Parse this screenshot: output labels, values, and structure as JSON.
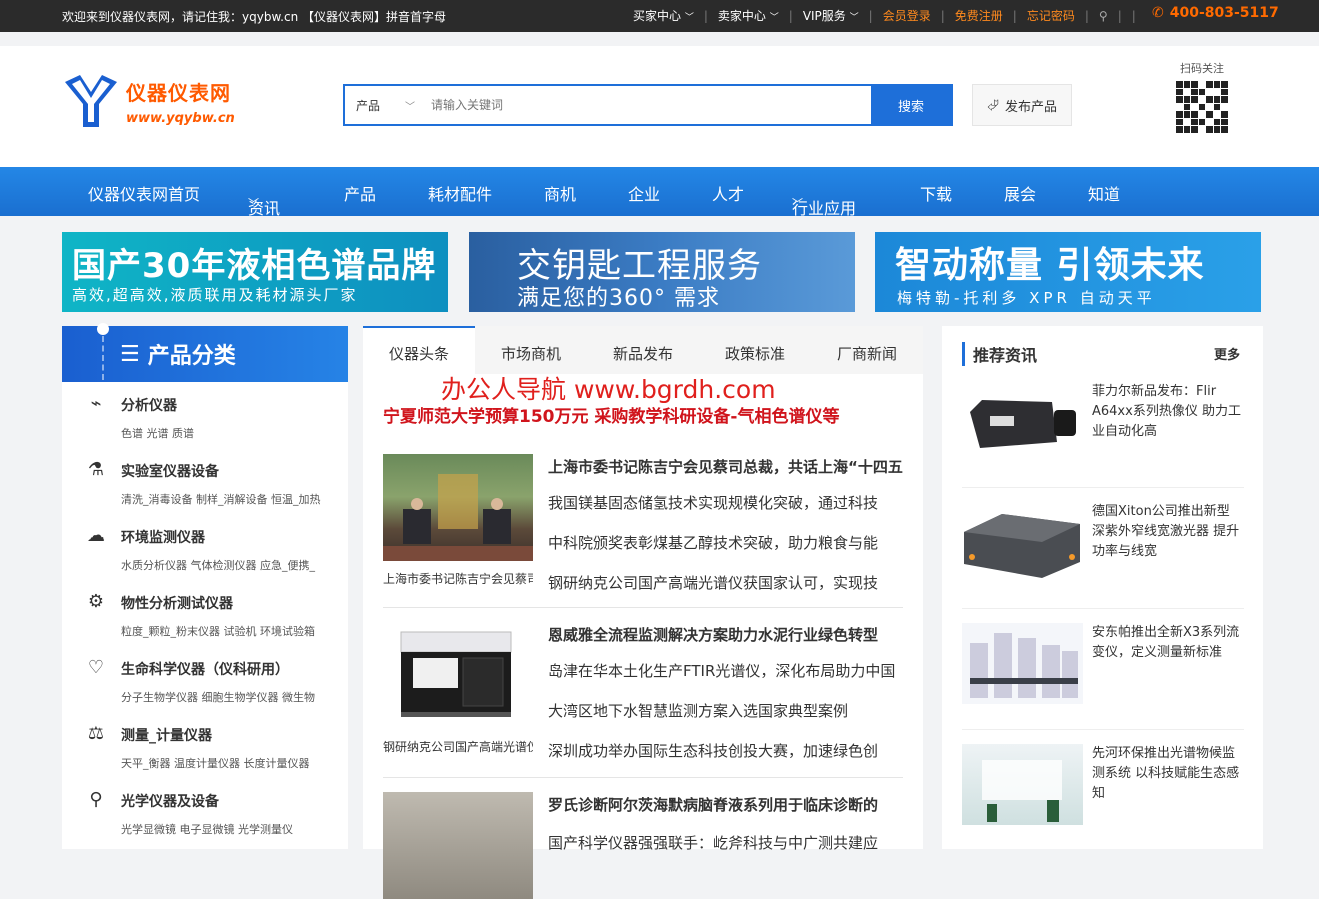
{
  "topbar": {
    "welcome": "欢迎来到仪器仪表网，请记住我：yqybw.cn 【仪器仪表网】拼音首字母",
    "buyer": "买家中心",
    "seller": "卖家中心",
    "vip": "VIP服务",
    "login": "会员登录",
    "register": "免费注册",
    "forgot": "忘记密码",
    "phone": "400-803-5117"
  },
  "header": {
    "logo_name": "仪器仪表网",
    "logo_url": "www.yqybw.cn",
    "search_category": "产品",
    "search_placeholder": "请输入关键词",
    "search_button": "搜索",
    "publish": "发布产品",
    "qr_label": "扫码关注"
  },
  "nav": [
    "仪器仪表网首页",
    "资讯",
    "产品",
    "耗材配件",
    "商机",
    "企业",
    "人才",
    "行业应用",
    "下载",
    "展会",
    "知道"
  ],
  "banners": [
    {
      "line1": "国产30年液相色谱品牌",
      "line2": "高效,超高效,液质联用及耗材源头厂家"
    },
    {
      "line1": "交钥匙工程服务",
      "line2": "满足您的360° 需求"
    },
    {
      "line1": "智动称量 引领未来",
      "line2": "梅特勒-托利多 XPR 自动天平"
    }
  ],
  "sidebar": {
    "title": "产品分类",
    "categories": [
      {
        "title": "分析仪器",
        "sub": "色谱 光谱 质谱"
      },
      {
        "title": "实验室仪器设备",
        "sub": "清洗_消毒设备 制样_消解设备 恒温_加热"
      },
      {
        "title": "环境监测仪器",
        "sub": "水质分析仪器 气体检测仪器 应急_便携_"
      },
      {
        "title": "物性分析测试仪器",
        "sub": "粒度_颗粒_粉末仪器 试验机 环境试验箱"
      },
      {
        "title": "生命科学仪器（仪科研用）",
        "sub": "分子生物学仪器 细胞生物学仪器 微生物"
      },
      {
        "title": "测量_计量仪器",
        "sub": "天平_衡器 温度计量仪器 长度计量仪器"
      },
      {
        "title": "光学仪器及设备",
        "sub": "光学显微镜 电子显微镜 光学测量仪"
      }
    ]
  },
  "main": {
    "tabs": [
      "仪器头条",
      "市场商机",
      "新品发布",
      "政策标准",
      "厂商新闻"
    ],
    "watermark": "办公人导航  www.bgrdh.com",
    "headline": "宁夏师范大学预算150万元 采购教学科研设备-气相色谱仪等",
    "articles": [
      {
        "caption": "上海市委书记陈吉宁会见蔡司总裁",
        "title": "上海市委书记陈吉宁会见蔡司总裁，共话上海“十四五”发展",
        "lines": [
          "我国镁基固态储氢技术实现规模化突破，通过科技",
          "中科院颁奖表彰煤基乙醇技术突破，助力粮食与能",
          "钢研纳克公司国产高端光谱仪获国家认可，实现技"
        ]
      },
      {
        "caption": "钢研纳克公司国产高端光谱仪",
        "title": "恩威雅全流程监测解决方案助力水泥行业绿色转型",
        "lines": [
          "岛津在华本土化生产FTIR光谱仪，深化布局助力中国",
          "大湾区地下水智慧监测方案入选国家典型案例",
          "深圳成功举办国际生态科技创投大赛，加速绿色创"
        ]
      },
      {
        "caption": "",
        "title": "罗氏诊断阿尔茨海默病脑脊液系列用于临床诊断的",
        "lines": [
          "国产科学仪器强强联手：屹斧科技与中广测共建应"
        ]
      }
    ]
  },
  "right": {
    "title": "推荐资讯",
    "more": "更多",
    "items": [
      {
        "text": "菲力尔新品发布：Flir A64xx系列热像仪 助力工业自动化高"
      },
      {
        "text": "德国Xiton公司推出新型深紫外窄线宽激光器 提升功率与线宽"
      },
      {
        "text": "安东帕推出全新X3系列流变仪，定义测量新标准"
      },
      {
        "text": "先河环保推出光谱物候监测系统 以科技赋能生态感知"
      }
    ]
  }
}
